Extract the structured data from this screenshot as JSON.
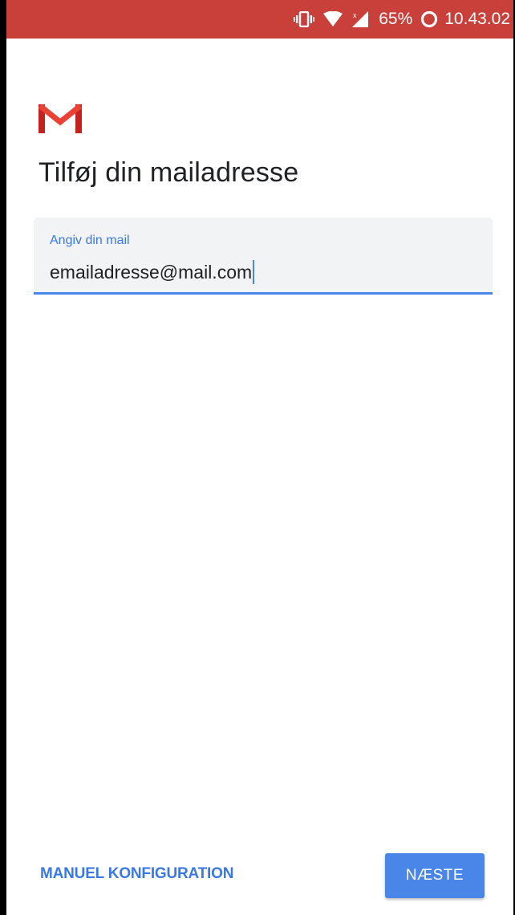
{
  "status_bar": {
    "icons": [
      "vibrate-icon",
      "wifi-icon",
      "cellular-signal-icon",
      "battery-ring-icon"
    ],
    "battery": "65%",
    "time": "10.43.02",
    "bg_color": "#c9403a"
  },
  "header": {
    "logo_icon": "gmail-logo-icon",
    "title": "Tilføj din mailadresse"
  },
  "email_field": {
    "label": "Angiv din mail",
    "value": "emailadresse@mail.com",
    "accent_color": "#4a85e8"
  },
  "footer": {
    "manual_config_label": "MANUEL KONFIGURATION",
    "next_label": "NÆSTE"
  }
}
